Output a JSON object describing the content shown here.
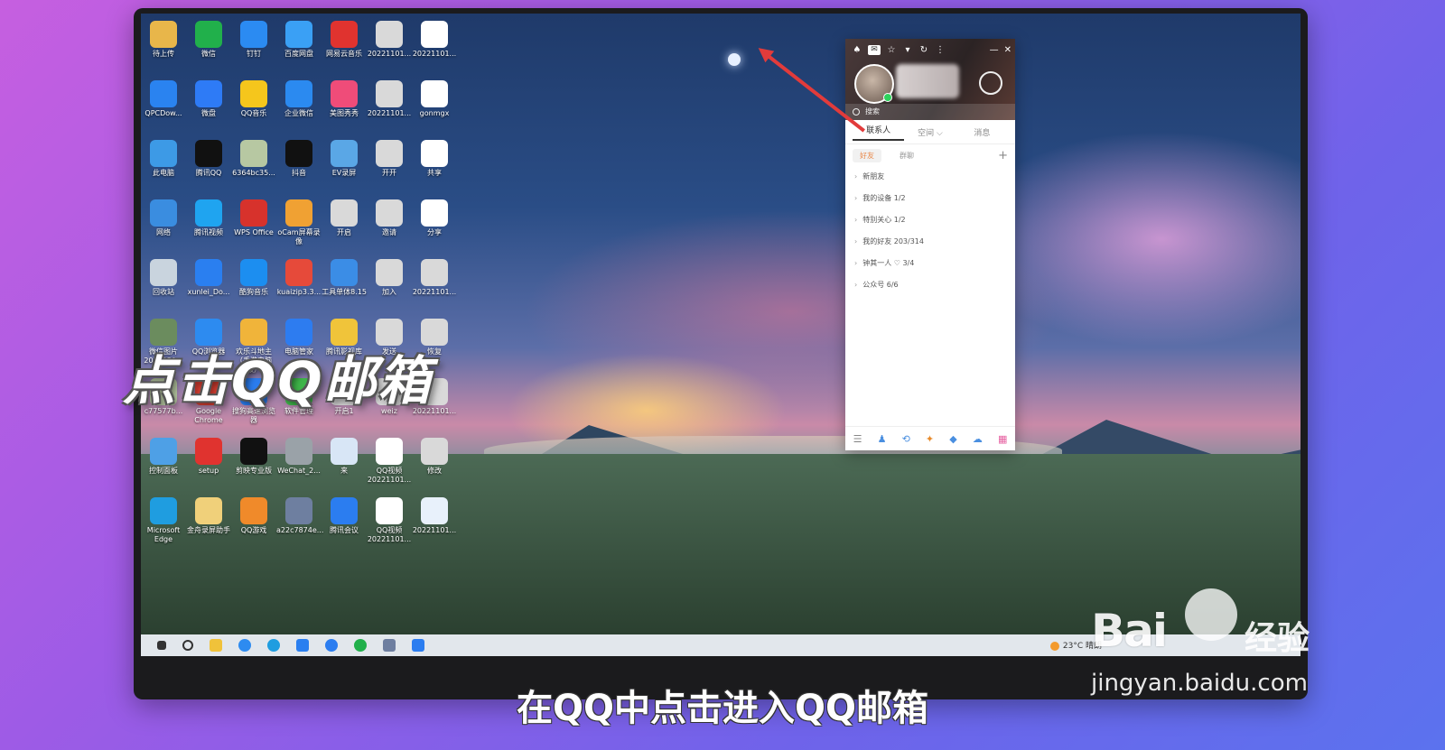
{
  "overlay_title": "点击QQ邮箱",
  "subtitle": "在QQ中点击进入QQ邮箱",
  "watermark": {
    "brand": "Bai",
    "cn": "经验",
    "url": "jingyan.baidu.com"
  },
  "desktop_icons": [
    {
      "label": "待上传",
      "color": "#e8b64a"
    },
    {
      "label": "微信",
      "color": "#21b04b"
    },
    {
      "label": "钉钉",
      "color": "#2b8bf2"
    },
    {
      "label": "百度网盘",
      "color": "#3aa0f5"
    },
    {
      "label": "网易云音乐",
      "color": "#e0332f"
    },
    {
      "label": "20221101...",
      "color": "#d9d9d9"
    },
    {
      "label": "20221101...",
      "color": "#ffffff"
    },
    {
      "label": "QPCDow...",
      "color": "#2a83f0"
    },
    {
      "label": "微盘",
      "color": "#2e7bf6"
    },
    {
      "label": "QQ音乐",
      "color": "#f5c61c"
    },
    {
      "label": "企业微信",
      "color": "#2b8af0"
    },
    {
      "label": "美图秀秀",
      "color": "#ef4c79"
    },
    {
      "label": "20221101...",
      "color": "#d9d9d9"
    },
    {
      "label": "gonmgx",
      "color": "#ffffff"
    },
    {
      "label": "此电脑",
      "color": "#3d9ae6"
    },
    {
      "label": "腾讯QQ",
      "color": "#111111"
    },
    {
      "label": "6364bc35...",
      "color": "#b7c8a2"
    },
    {
      "label": "抖音",
      "color": "#111111"
    },
    {
      "label": "EV录屏",
      "color": "#5aa7e6"
    },
    {
      "label": "开开",
      "color": "#d9d9d9"
    },
    {
      "label": "共享",
      "color": "#ffffff"
    },
    {
      "label": "网络",
      "color": "#3a8de0"
    },
    {
      "label": "腾讯视频",
      "color": "#1fa4f0"
    },
    {
      "label": "WPS Office",
      "color": "#d7322c"
    },
    {
      "label": "oCam屏幕录像",
      "color": "#f0a133"
    },
    {
      "label": "开启",
      "color": "#d9d9d9"
    },
    {
      "label": "邀请",
      "color": "#d9d9d9"
    },
    {
      "label": "分享",
      "color": "#ffffff"
    },
    {
      "label": "回收站",
      "color": "#c9d4de"
    },
    {
      "label": "xunlei_Do...",
      "color": "#2a7ff0"
    },
    {
      "label": "酷狗音乐",
      "color": "#1c8ef0"
    },
    {
      "label": "kuaizip3.3...",
      "color": "#e64a3a"
    },
    {
      "label": "工具单体8.15",
      "color": "#3b8de6"
    },
    {
      "label": "加入",
      "color": "#d9d9d9"
    },
    {
      "label": "20221101...",
      "color": "#d9d9d9"
    },
    {
      "label": "微信图片2022050...",
      "color": "#6b8c5e"
    },
    {
      "label": "QQ浏览器",
      "color": "#2d8bf0"
    },
    {
      "label": "欢乐斗地主（手游电脑版）",
      "color": "#f0b43a"
    },
    {
      "label": "电脑管家",
      "color": "#2d7cf0"
    },
    {
      "label": "腾讯影视库",
      "color": "#f0c43a"
    },
    {
      "label": "发送",
      "color": "#d9d9d9"
    },
    {
      "label": "恢复",
      "color": "#d9d9d9"
    },
    {
      "label": "c77577b...",
      "color": "#b7c8a2"
    },
    {
      "label": "Google Chrome",
      "color": "#e34133"
    },
    {
      "label": "搜狗高速浏览器",
      "color": "#2b7df0"
    },
    {
      "label": "软件管理",
      "color": "#3fb64a"
    },
    {
      "label": "开启1",
      "color": "#d9d9d9"
    },
    {
      "label": "weiz",
      "color": "#d9d9d9"
    },
    {
      "label": "20221101...",
      "color": "#d9d9d9"
    },
    {
      "label": "控制面板",
      "color": "#4ea0e6"
    },
    {
      "label": "setup",
      "color": "#e0332f"
    },
    {
      "label": "剪映专业版",
      "color": "#111111"
    },
    {
      "label": "WeChat_2...",
      "color": "#9aa2a8"
    },
    {
      "label": "来",
      "color": "#d8e6f6"
    },
    {
      "label": "QQ视频20221101...",
      "color": "#ffffff"
    },
    {
      "label": "修改",
      "color": "#d9d9d9"
    },
    {
      "label": "Microsoft Edge",
      "color": "#1f9de0"
    },
    {
      "label": "金舟录屏助手",
      "color": "#f0d07a"
    },
    {
      "label": "QQ游戏",
      "color": "#f08a2a"
    },
    {
      "label": "a22c7874e...",
      "color": "#6e7fa0"
    },
    {
      "label": "腾讯会议",
      "color": "#2b7df0"
    },
    {
      "label": "QQ视频20221101...",
      "color": "#ffffff"
    },
    {
      "label": "20221101...",
      "color": "#e8f1fb"
    }
  ],
  "qq": {
    "search_placeholder": "搜索",
    "tabs": [
      "联系人",
      "空间 ⌵",
      "消息"
    ],
    "subtabs": [
      "好友",
      "群聊"
    ],
    "groups": [
      "新朋友",
      "我的设备  1/2",
      "特别关心  1/2",
      "我的好友  203/314",
      "钟其一人 ♡  3/4",
      "公众号  6/6"
    ]
  },
  "taskbar": {
    "weather": "23°C  晴朗"
  }
}
